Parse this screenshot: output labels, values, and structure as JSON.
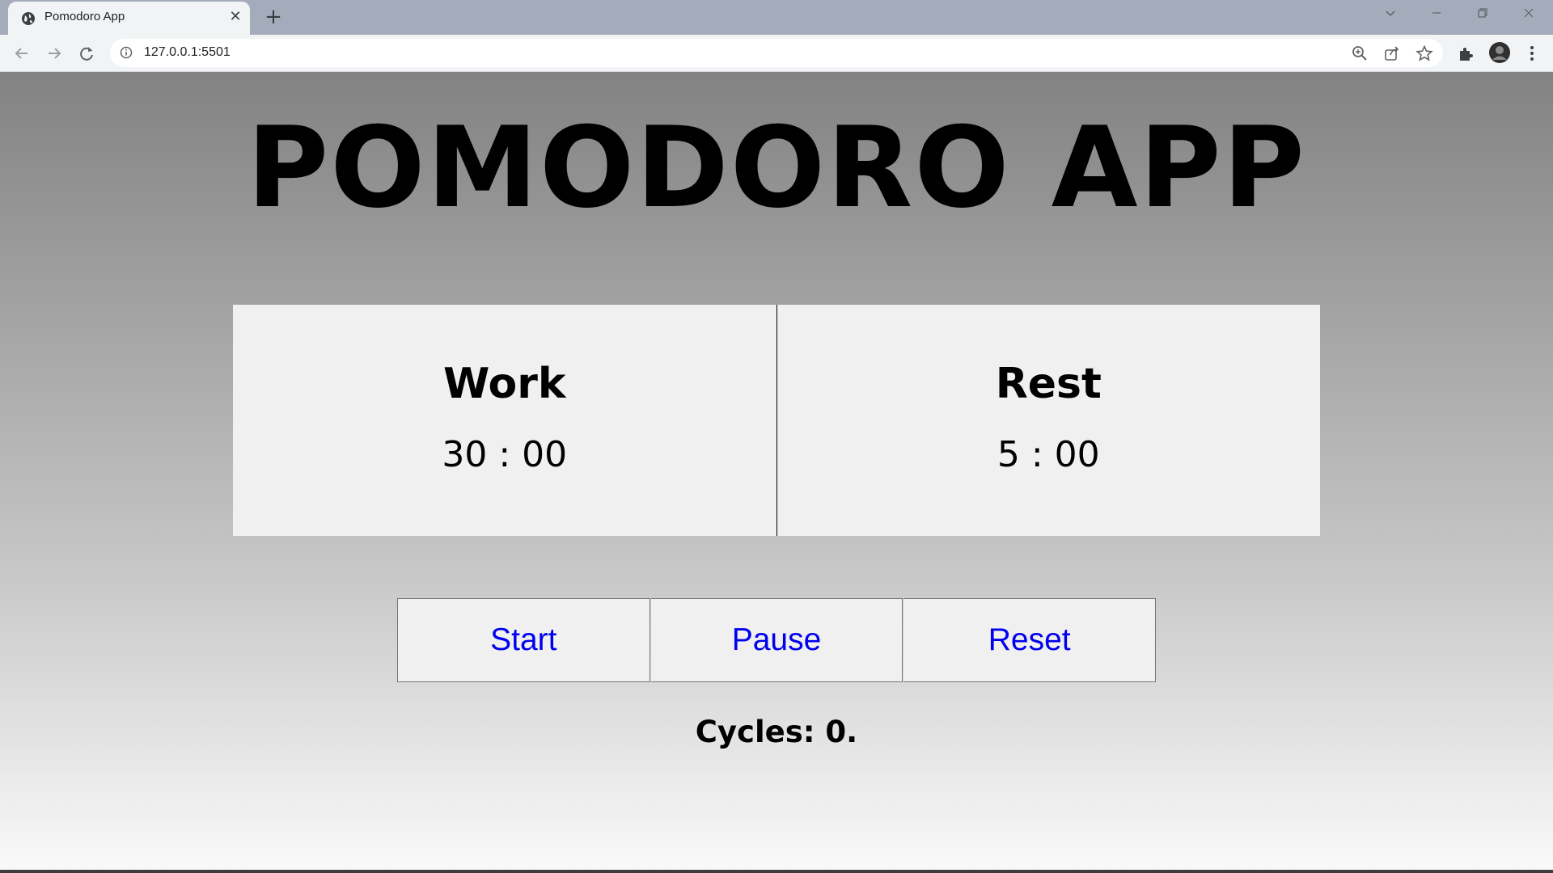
{
  "browser": {
    "tab_title": "Pomodoro App",
    "url": "127.0.0.1:5501"
  },
  "app": {
    "title": "POMODORO APP",
    "work": {
      "label": "Work",
      "time": "30 : 00"
    },
    "rest": {
      "label": "Rest",
      "time": "5 : 00"
    },
    "buttons": {
      "start": "Start",
      "pause": "Pause",
      "reset": "Reset"
    },
    "cycles": "Cycles: 0."
  },
  "colors": {
    "button_text": "#0000ee",
    "panel_bg": "#f0f0f0"
  }
}
